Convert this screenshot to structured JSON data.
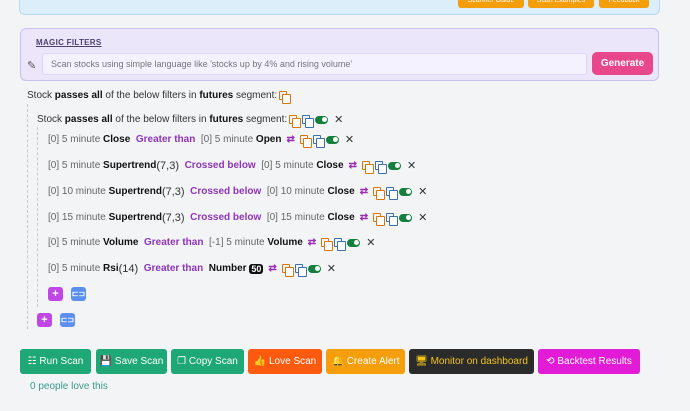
{
  "top_buttons": [
    "Scanner Guide",
    "Scan Examples",
    "Feedback"
  ],
  "magic": {
    "title": "MAGIC FILTERS",
    "placeholder": "Scan stocks using simple language like 'stocks up by 4% and rising volume'",
    "generate_label": "Generate"
  },
  "outer": {
    "pre": "Stock",
    "bold1": "passes all",
    "mid": "of the below filters in",
    "bold2": "futures",
    "post": "segment:"
  },
  "inner": {
    "pre": "Stock",
    "bold1": "passes all",
    "mid": "of the below filters in",
    "bold2": "futures",
    "post": "segment:"
  },
  "filters": [
    {
      "idx": "[0]",
      "tf": "5 minute",
      "ind": "Close",
      "param": "",
      "op": "Greater than",
      "rhs_idx": "[0]",
      "rhs_tf": "5 minute",
      "rhs_ind": "Open"
    },
    {
      "idx": "[0]",
      "tf": "5 minute",
      "ind": "Supertrend",
      "param": "(7,3)",
      "op": "Crossed below",
      "rhs_idx": "[0]",
      "rhs_tf": "5 minute",
      "rhs_ind": "Close"
    },
    {
      "idx": "[0]",
      "tf": "10 minute",
      "ind": "Supertrend",
      "param": "(7,3)",
      "op": "Crossed below",
      "rhs_idx": "[0]",
      "rhs_tf": "10 minute",
      "rhs_ind": "Close"
    },
    {
      "idx": "[0]",
      "tf": "15 minute",
      "ind": "Supertrend",
      "param": "(7,3)",
      "op": "Crossed below",
      "rhs_idx": "[0]",
      "rhs_tf": "15 minute",
      "rhs_ind": "Close"
    },
    {
      "idx": "[0]",
      "tf": "5 minute",
      "ind": "Volume",
      "param": "",
      "op": "Greater than",
      "rhs_idx": "[-1]",
      "rhs_tf": "5 minute",
      "rhs_ind": "Volume"
    },
    {
      "idx": "[0]",
      "tf": "5 minute",
      "ind": "Rsi",
      "param": "(14)",
      "op": "Greater than",
      "rhs_idx": "",
      "rhs_tf": "",
      "rhs_ind": "Number",
      "rhs_num": "50"
    }
  ],
  "actions": {
    "run": "Run Scan",
    "save": "Save Scan",
    "copy": "Copy Scan",
    "love": "Love Scan",
    "alert": "Create Alert",
    "monitor": "Monitor on dashboard",
    "backtest": "Backtest Results"
  },
  "love_count_text": "0 people love this",
  "colors": {
    "green": "#1fa877",
    "orange": "#fb5a0f",
    "amber": "#f59e0b",
    "dark": "#2b2b2b",
    "magenta": "#e21bd6",
    "generate": "#e9478b",
    "operator": "#8e35b8"
  }
}
